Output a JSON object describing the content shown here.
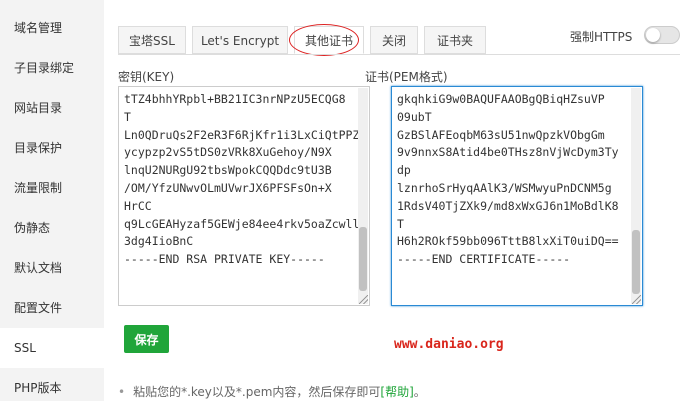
{
  "sidebar": {
    "items": [
      {
        "label": "域名管理"
      },
      {
        "label": "子目录绑定"
      },
      {
        "label": "网站目录"
      },
      {
        "label": "目录保护"
      },
      {
        "label": "流量限制"
      },
      {
        "label": "伪静态"
      },
      {
        "label": "默认文档"
      },
      {
        "label": "配置文件"
      },
      {
        "label": "SSL",
        "active": true
      },
      {
        "label": "PHP版本"
      }
    ]
  },
  "tabs": [
    {
      "label": "宝塔SSL"
    },
    {
      "label": "Let's Encrypt"
    },
    {
      "label": "其他证书",
      "active": true,
      "highlight_color": "#d22222"
    },
    {
      "label": "关闭"
    },
    {
      "label": "证书夹"
    }
  ],
  "https": {
    "label": "强制HTTPS",
    "enabled": false
  },
  "key": {
    "label": "密钥(KEY)",
    "lines": [
      "tTZ4bhhYRpbl+BB21IC3nrNPzU5ECQG8",
      "T",
      "Ln0QDruQs2F2eR3F6RjKfr1i3LxCiQtPPZ",
      "ycypzp2vS5tDS0zVRk8XuGehoy/N9X",
      "lnqU2NURgU92tbsWpokCQQDdc9tU3B",
      "/OM/YfzUNwvOLmUVwrJX6PFSFsOn+X",
      "HrCC",
      "q9LcGEAHyzaf5GEWje84ee4rkv5oaZcwll",
      "3dg4IioBnC",
      "-----END RSA PRIVATE KEY-----"
    ],
    "scroll_position": 0.9
  },
  "cert": {
    "label": "证书(PEM格式)",
    "lines": [
      "gkqhkiG9w0BAQUFAAOBgQBiqHZsuVP",
      "09ubT",
      "GzBSlAFEoqbM63sU51nwQpzkVObgGm",
      "9v9nnxS8Atid4be0THsz8nVjWcDym3Ty",
      "dp",
      "lznrhoSrHyqAAlK3/WSMwyuPnDCNM5g",
      "1RdsV40TjZXk9/md8xWxGJ6n1MoBdlK8",
      "T",
      "H6h2ROkf59bb096TttB8lxXiT0uiDQ==",
      "-----END CERTIFICATE-----"
    ],
    "scroll_position": 0.92
  },
  "save_label": "保存",
  "watermark": "www.daniao.org",
  "note": {
    "bullet": "•",
    "text": "粘贴您的*.key以及*.pem内容，然后保存即可",
    "link": "[帮助]",
    "end": "。"
  },
  "colors": {
    "accent": "#20a53a",
    "focus": "#2a8ad4",
    "watermark": "#d9261c"
  }
}
